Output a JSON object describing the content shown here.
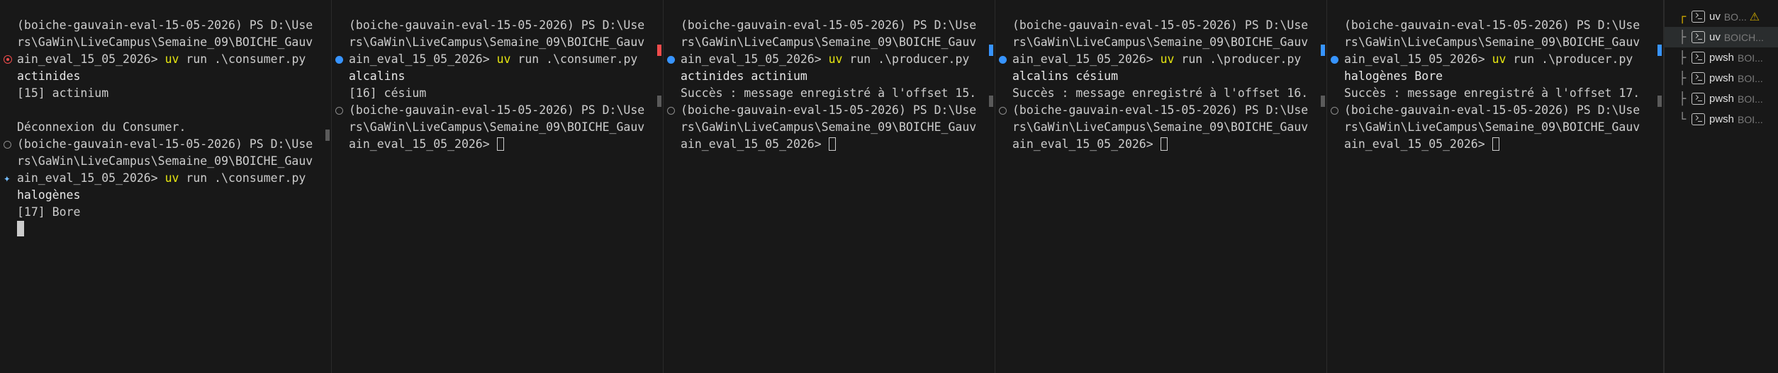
{
  "panes": [
    {
      "lines": [
        {
          "text": "(boiche-gauvain-eval-15-05-2026) PS D:\\Use"
        },
        {
          "text": "rs\\GaWin\\LiveCampus\\Semaine_09\\BOICHE_Gauv"
        },
        {
          "prefix": "ain_eval_15_05_2026> ",
          "cmd": "uv",
          "rest": " run .\\consumer.py",
          "deco": "error-dot"
        },
        {
          "text": "actinides",
          "hl": true
        },
        {
          "text": "[15] actinium"
        },
        {
          "text": ""
        },
        {
          "text": "Déconnexion du Consumer."
        },
        {
          "text": "(boiche-gauvain-eval-15-05-2026) PS D:\\Use",
          "deco": "empty-dot"
        },
        {
          "text": "rs\\GaWin\\LiveCampus\\Semaine_09\\BOICHE_Gauv"
        },
        {
          "prefix": "ain_eval_15_05_2026> ",
          "cmd": "uv",
          "rest": " run .\\consumer.py",
          "deco": "sparkle"
        },
        {
          "text": "halogènes",
          "hl": true
        },
        {
          "text": "[17] Bore"
        },
        {
          "cursor": "block"
        }
      ]
    },
    {
      "lines": [
        {
          "text": "(boiche-gauvain-eval-15-05-2026) PS D:\\Use"
        },
        {
          "text": "rs\\GaWin\\LiveCampus\\Semaine_09\\BOICHE_Gauv"
        },
        {
          "prefix": "ain_eval_15_05_2026> ",
          "cmd": "uv",
          "rest": " run .\\consumer.py",
          "deco": "blue-dot"
        },
        {
          "text": "alcalins",
          "hl": true
        },
        {
          "text": "[16] césium"
        },
        {
          "text": "(boiche-gauvain-eval-15-05-2026) PS D:\\Use",
          "deco": "empty-dot"
        },
        {
          "text": "rs\\GaWin\\LiveCampus\\Semaine_09\\BOICHE_Gauv"
        },
        {
          "prefix": "ain_eval_15_05_2026> ",
          "cursor": "box"
        }
      ]
    },
    {
      "lines": [
        {
          "text": "(boiche-gauvain-eval-15-05-2026) PS D:\\Use"
        },
        {
          "text": "rs\\GaWin\\LiveCampus\\Semaine_09\\BOICHE_Gauv"
        },
        {
          "prefix": "ain_eval_15_05_2026> ",
          "cmd": "uv",
          "rest": " run .\\producer.py",
          "deco": "blue-dot"
        },
        {
          "text": "actinides actinium",
          "hl": true
        },
        {
          "text": "Succès : message enregistré à l'offset 15."
        },
        {
          "text": "(boiche-gauvain-eval-15-05-2026) PS D:\\Use",
          "deco": "empty-dot"
        },
        {
          "text": "rs\\GaWin\\LiveCampus\\Semaine_09\\BOICHE_Gauv"
        },
        {
          "prefix": "ain_eval_15_05_2026> ",
          "cursor": "box"
        }
      ]
    },
    {
      "lines": [
        {
          "text": "(boiche-gauvain-eval-15-05-2026) PS D:\\Use"
        },
        {
          "text": "rs\\GaWin\\LiveCampus\\Semaine_09\\BOICHE_Gauv"
        },
        {
          "prefix": "ain_eval_15_05_2026> ",
          "cmd": "uv",
          "rest": " run .\\producer.py",
          "deco": "blue-dot"
        },
        {
          "text": "alcalins césium",
          "hl": true
        },
        {
          "text": "Succès : message enregistré à l'offset 16."
        },
        {
          "text": "(boiche-gauvain-eval-15-05-2026) PS D:\\Use",
          "deco": "empty-dot"
        },
        {
          "text": "rs\\GaWin\\LiveCampus\\Semaine_09\\BOICHE_Gauv"
        },
        {
          "prefix": "ain_eval_15_05_2026> ",
          "cursor": "box"
        }
      ]
    },
    {
      "lines": [
        {
          "text": "(boiche-gauvain-eval-15-05-2026) PS D:\\Use"
        },
        {
          "text": "rs\\GaWin\\LiveCampus\\Semaine_09\\BOICHE_Gauv"
        },
        {
          "prefix": "ain_eval_15_05_2026> ",
          "cmd": "uv",
          "rest": " run .\\producer.py",
          "deco": "blue-dot"
        },
        {
          "text": "halogènes Bore",
          "hl": true
        },
        {
          "text": "Succès : message enregistré à l'offset 17."
        },
        {
          "text": "(boiche-gauvain-eval-15-05-2026) PS D:\\Use",
          "deco": "empty-dot"
        },
        {
          "text": "rs\\GaWin\\LiveCampus\\Semaine_09\\BOICHE_Gauv"
        },
        {
          "prefix": "ain_eval_15_05_2026> ",
          "cursor": "box"
        }
      ]
    }
  ],
  "terminal_tabs": [
    {
      "tree": "┌",
      "name": "uv",
      "desc": "BO...",
      "warning": true,
      "selected": false
    },
    {
      "tree": "├",
      "name": "uv",
      "desc": "BOICH...",
      "warning": false,
      "selected": true
    },
    {
      "tree": "├",
      "name": "pwsh",
      "desc": "BOI...",
      "warning": false,
      "selected": false
    },
    {
      "tree": "├",
      "name": "pwsh",
      "desc": "BOI...",
      "warning": false,
      "selected": false
    },
    {
      "tree": "├",
      "name": "pwsh",
      "desc": "BOI...",
      "warning": false,
      "selected": false
    },
    {
      "tree": "└",
      "name": "pwsh",
      "desc": "BOI...",
      "warning": false,
      "selected": false
    }
  ],
  "colors": {
    "background": "#181818",
    "text": "#cccccc",
    "command": "#e5e510",
    "accent_blue": "#3794ff",
    "error": "#f14c4c",
    "warning": "#cca700"
  },
  "icons": {
    "error": "error-circle-icon",
    "success": "command-success-icon",
    "empty": "command-decoration-icon",
    "sparkle": "sparkle-icon",
    "terminal": "terminal-icon",
    "warning": "warning-icon"
  }
}
